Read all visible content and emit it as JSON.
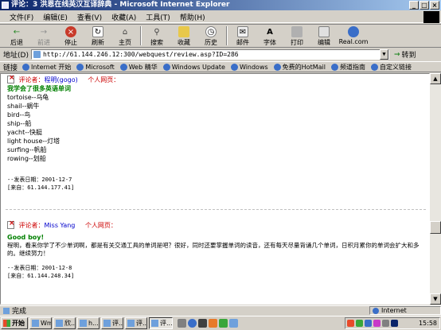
{
  "window": {
    "title": "评论：3 洪恩在线英汉互译辞典 - Microsoft Internet Explorer"
  },
  "menu": [
    "文件(F)",
    "编辑(E)",
    "查看(V)",
    "收藏(A)",
    "工具(T)",
    "帮助(H)"
  ],
  "toolbar": {
    "back": "后退",
    "forward": "前进",
    "stop": "停止",
    "refresh": "刷新",
    "home": "主页",
    "search": "搜索",
    "favorites": "收藏",
    "history": "历史",
    "mail": "邮件",
    "font": "字体",
    "print": "打印",
    "edit": "编辑",
    "real": "Real.com"
  },
  "address": {
    "label": "地址(D)",
    "url": "http://61.144.246.12:300/webquest/review.asp?ID=286",
    "go": "转到"
  },
  "links": {
    "label": "链接",
    "items": [
      "Internet 开始",
      "Microsoft",
      "Web 精华",
      "Windows Update",
      "Windows",
      "免费的HotMail",
      "频道指南",
      "自定义链接"
    ]
  },
  "posts": [
    {
      "reviewer_label": "评论者：",
      "reviewer": "程明(gogo)",
      "personal": "个人网页：",
      "title": "我学会了很多英语单词",
      "lines": [
        "tortoise--乌龟",
        "shail--蜗牛",
        "bird--鸟",
        "ship--船",
        "yacht--快艇",
        "light house--灯塔",
        "surfing--帆船",
        "rowing--划船"
      ],
      "date": "--发表日期：2001-12-7",
      "from": "[来自：61.144.177.41]"
    },
    {
      "reviewer_label": "评论者：",
      "reviewer": "Miss Yang",
      "personal": "个人网页：",
      "title": "Good boy!",
      "body": "程明，看来你学了不少单词啊，都是有关交通工具的单词是吧？很好，同时还要掌握单词的读音，还有每天尽量背诵几个单词，日积月累你的单词会扩大和多的。继续努力！",
      "date": "--发表日期：2001-12-8",
      "from": "[来自：61.144.248.34]"
    }
  ],
  "status": {
    "text": "完成",
    "zone": "Internet"
  },
  "taskbar": {
    "start": "开始",
    "tasks": [
      "Wm...",
      "欣...",
      "h...",
      "评...",
      "评...",
      "评..."
    ],
    "clock": "15:58"
  }
}
